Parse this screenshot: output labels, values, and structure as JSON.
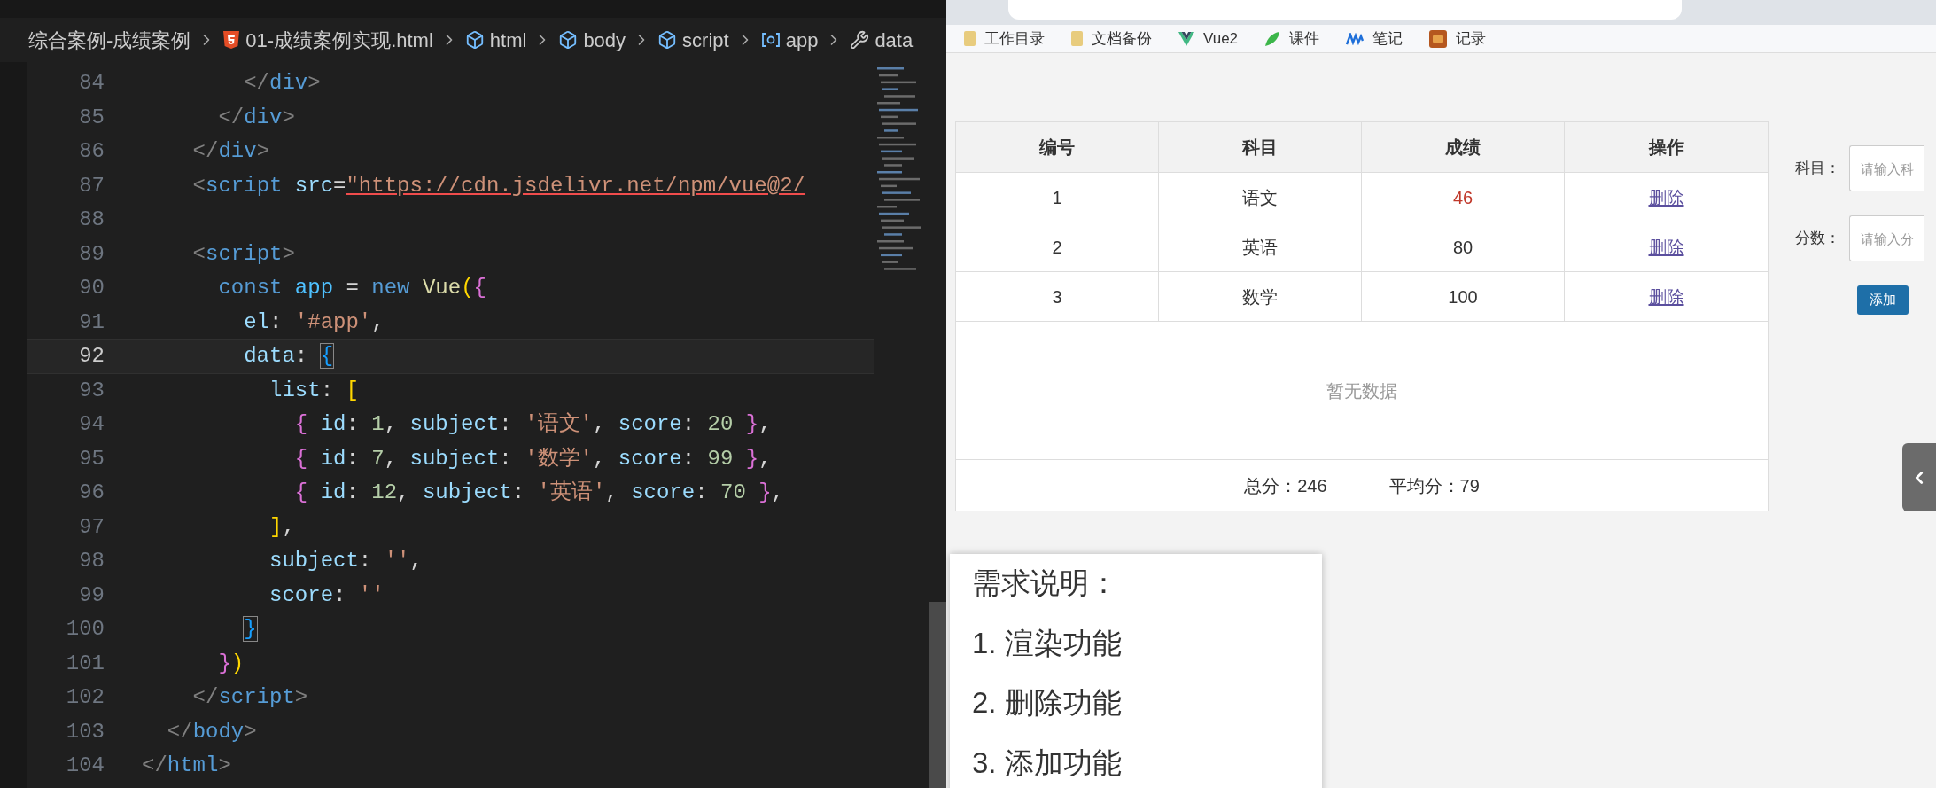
{
  "editor": {
    "breadcrumb": [
      {
        "kind": "folder",
        "text": "综合案例-成绩案例"
      },
      {
        "kind": "html",
        "text": "01-成绩案例实现.html"
      },
      {
        "kind": "element",
        "text": "html"
      },
      {
        "kind": "element",
        "text": "body"
      },
      {
        "kind": "element",
        "text": "script"
      },
      {
        "kind": "variable",
        "text": "app"
      },
      {
        "kind": "property",
        "text": "data"
      }
    ],
    "lines": [
      {
        "number": "84",
        "current": false,
        "tokens": [
          {
            "text": "        </",
            "kind": "tag"
          },
          {
            "text": "div",
            "kind": "tagname"
          },
          {
            "text": ">",
            "kind": "tag"
          }
        ]
      },
      {
        "number": "85",
        "current": false,
        "tokens": [
          {
            "text": "      </",
            "kind": "tag"
          },
          {
            "text": "div",
            "kind": "tagname"
          },
          {
            "text": ">",
            "kind": "tag"
          }
        ]
      },
      {
        "number": "86",
        "current": false,
        "tokens": [
          {
            "text": "    </",
            "kind": "tag"
          },
          {
            "text": "div",
            "kind": "tagname"
          },
          {
            "text": ">",
            "kind": "tag"
          }
        ]
      },
      {
        "number": "87",
        "current": false,
        "tokens": [
          {
            "text": "    <",
            "kind": "tag"
          },
          {
            "text": "script",
            "kind": "tagname"
          },
          {
            "text": " src",
            "kind": "attr"
          },
          {
            "text": "=",
            "kind": "punct"
          },
          {
            "text": "\"https://cdn.jsdelivr.net/npm/vue@2/",
            "kind": "url"
          }
        ]
      },
      {
        "number": "88",
        "current": false
      },
      {
        "number": "89",
        "current": false,
        "tokens": [
          {
            "text": "    <",
            "kind": "tag"
          },
          {
            "text": "script",
            "kind": "tagname"
          },
          {
            "text": ">",
            "kind": "tag"
          }
        ]
      },
      {
        "number": "90",
        "current": false,
        "tokens": [
          {
            "text": "      const",
            "kind": "keyword"
          },
          {
            "text": " app",
            "kind": "var"
          },
          {
            "text": " = ",
            "kind": "punct"
          },
          {
            "text": "new",
            "kind": "keyword"
          },
          {
            "text": " Vue",
            "kind": "func"
          },
          {
            "text": "(",
            "kind": "b1"
          },
          {
            "text": "{",
            "kind": "b2"
          }
        ]
      },
      {
        "number": "91",
        "current": false,
        "tokens": [
          {
            "text": "        el",
            "kind": "prop"
          },
          {
            "text": ": ",
            "kind": "punct"
          },
          {
            "text": "'#app'",
            "kind": "str"
          },
          {
            "text": ",",
            "kind": "punct"
          }
        ]
      },
      {
        "number": "92",
        "current": true,
        "tokens": [
          {
            "text": "        data",
            "kind": "prop"
          },
          {
            "text": ": ",
            "kind": "punct"
          },
          {
            "text": "{",
            "kind": "b3match"
          }
        ]
      },
      {
        "number": "93",
        "current": false,
        "tokens": [
          {
            "text": "          list",
            "kind": "prop"
          },
          {
            "text": ": ",
            "kind": "punct"
          },
          {
            "text": "[",
            "kind": "b1"
          }
        ]
      },
      {
        "number": "94",
        "current": false,
        "tokens": [
          {
            "text": "            {",
            "kind": "b2"
          },
          {
            "text": " id",
            "kind": "prop"
          },
          {
            "text": ": ",
            "kind": "punct"
          },
          {
            "text": "1",
            "kind": "num"
          },
          {
            "text": ", ",
            "kind": "punct"
          },
          {
            "text": "subject",
            "kind": "prop"
          },
          {
            "text": ": ",
            "kind": "punct"
          },
          {
            "text": "'语文'",
            "kind": "str"
          },
          {
            "text": ", ",
            "kind": "punct"
          },
          {
            "text": "score",
            "kind": "prop"
          },
          {
            "text": ": ",
            "kind": "punct"
          },
          {
            "text": "20",
            "kind": "num"
          },
          {
            "text": " }",
            "kind": "b2"
          },
          {
            "text": ",",
            "kind": "punct"
          }
        ]
      },
      {
        "number": "95",
        "current": false,
        "tokens": [
          {
            "text": "            {",
            "kind": "b2"
          },
          {
            "text": " id",
            "kind": "prop"
          },
          {
            "text": ": ",
            "kind": "punct"
          },
          {
            "text": "7",
            "kind": "num"
          },
          {
            "text": ", ",
            "kind": "punct"
          },
          {
            "text": "subject",
            "kind": "prop"
          },
          {
            "text": ": ",
            "kind": "punct"
          },
          {
            "text": "'数学'",
            "kind": "str"
          },
          {
            "text": ", ",
            "kind": "punct"
          },
          {
            "text": "score",
            "kind": "prop"
          },
          {
            "text": ": ",
            "kind": "punct"
          },
          {
            "text": "99",
            "kind": "num"
          },
          {
            "text": " }",
            "kind": "b2"
          },
          {
            "text": ",",
            "kind": "punct"
          }
        ]
      },
      {
        "number": "96",
        "current": false,
        "tokens": [
          {
            "text": "            {",
            "kind": "b2"
          },
          {
            "text": " id",
            "kind": "prop"
          },
          {
            "text": ": ",
            "kind": "punct"
          },
          {
            "text": "12",
            "kind": "num"
          },
          {
            "text": ", ",
            "kind": "punct"
          },
          {
            "text": "subject",
            "kind": "prop"
          },
          {
            "text": ": ",
            "kind": "punct"
          },
          {
            "text": "'英语'",
            "kind": "str"
          },
          {
            "text": ", ",
            "kind": "punct"
          },
          {
            "text": "score",
            "kind": "prop"
          },
          {
            "text": ": ",
            "kind": "punct"
          },
          {
            "text": "70",
            "kind": "num"
          },
          {
            "text": " }",
            "kind": "b2"
          },
          {
            "text": ",",
            "kind": "punct"
          }
        ]
      },
      {
        "number": "97",
        "current": false,
        "tokens": [
          {
            "text": "          ]",
            "kind": "b1"
          },
          {
            "text": ",",
            "kind": "punct"
          }
        ]
      },
      {
        "number": "98",
        "current": false,
        "tokens": [
          {
            "text": "          subject",
            "kind": "prop"
          },
          {
            "text": ": ",
            "kind": "punct"
          },
          {
            "text": "''",
            "kind": "str"
          },
          {
            "text": ",",
            "kind": "punct"
          }
        ]
      },
      {
        "number": "99",
        "current": false,
        "tokens": [
          {
            "text": "          score",
            "kind": "prop"
          },
          {
            "text": ": ",
            "kind": "punct"
          },
          {
            "text": "''",
            "kind": "str"
          }
        ]
      },
      {
        "number": "100",
        "current": false,
        "tokens": [
          {
            "text": "        }",
            "kind": "b3match"
          }
        ]
      },
      {
        "number": "101",
        "current": false,
        "tokens": [
          {
            "text": "      }",
            "kind": "b2"
          },
          {
            "text": ")",
            "kind": "b1"
          }
        ]
      },
      {
        "number": "102",
        "current": false,
        "tokens": [
          {
            "text": "    </",
            "kind": "tag"
          },
          {
            "text": "script",
            "kind": "tagname"
          },
          {
            "text": ">",
            "kind": "tag"
          }
        ]
      },
      {
        "number": "103",
        "current": false,
        "tokens": [
          {
            "text": "  </",
            "kind": "tag"
          },
          {
            "text": "body",
            "kind": "tagname"
          },
          {
            "text": ">",
            "kind": "tag"
          }
        ]
      },
      {
        "number": "104",
        "current": false,
        "tokens": [
          {
            "text": "</",
            "kind": "tag"
          },
          {
            "text": "html",
            "kind": "tagname"
          },
          {
            "text": ">",
            "kind": "tag"
          }
        ]
      }
    ]
  },
  "browser": {
    "bookmarks": [
      {
        "kind": "folder",
        "label": "工作目录"
      },
      {
        "kind": "folder",
        "label": "文档备份"
      },
      {
        "kind": "vue",
        "label": "Vue2"
      },
      {
        "kind": "leaf",
        "label": "课件"
      },
      {
        "kind": "wave",
        "label": "笔记"
      },
      {
        "kind": "block",
        "label": "记录"
      }
    ],
    "table": {
      "columns": [
        "编号",
        "科目",
        "成绩",
        "操作"
      ],
      "rows": [
        {
          "id": "1",
          "subject": "语文",
          "score": "46",
          "failed": true,
          "action": "删除"
        },
        {
          "id": "2",
          "subject": "英语",
          "score": "80",
          "failed": false,
          "action": "删除"
        },
        {
          "id": "3",
          "subject": "数学",
          "score": "100",
          "failed": false,
          "action": "删除"
        }
      ],
      "empty_text": "暂无数据",
      "total": "总分：246",
      "average": "平均分：79"
    },
    "form": {
      "fields": [
        {
          "label": "科目：",
          "placeholder": "请输入科"
        },
        {
          "label": "分数：",
          "placeholder": "请输入分"
        }
      ],
      "button": "添加"
    },
    "requirements": {
      "title": "需求说明：",
      "items": [
        "1. 渲染功能",
        "2. 删除功能",
        "3. 添加功能"
      ]
    }
  }
}
